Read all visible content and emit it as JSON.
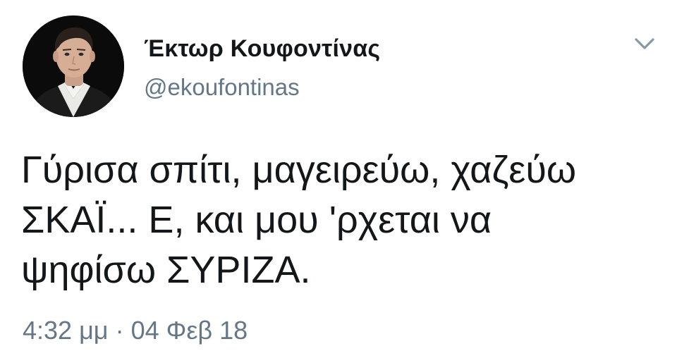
{
  "tweet": {
    "author": {
      "display_name": "Έκτωρ Κουφοντίνας",
      "handle": "@ekoufontinas"
    },
    "menu_icon": "chevron-down-icon",
    "text_lines": [
      "Γύρισα σπίτι, μαγειρεύω, χαζεύω",
      "ΣΚΑΪ... Ε, και μου 'ρχεται να",
      "ψηφίσω ΣΥΡΙΖΑ."
    ],
    "time": "4:32 μμ",
    "separator": "·",
    "date": "04 Φεβ 18"
  },
  "colors": {
    "text": "#14171a",
    "secondary": "#657786",
    "background": "#ffffff",
    "chevron": "#8899a6"
  }
}
